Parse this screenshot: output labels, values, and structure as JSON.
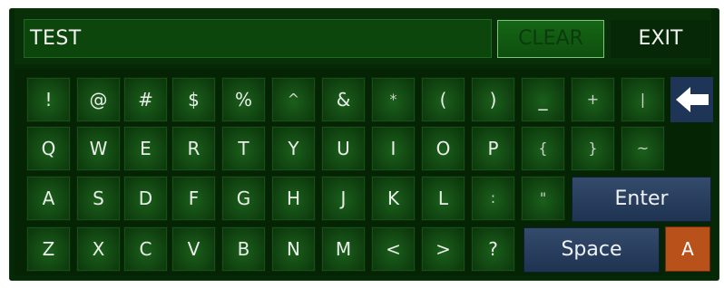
{
  "input": {
    "value": "TEST"
  },
  "buttons": {
    "clear": "CLEAR",
    "exit": "EXIT",
    "enter": "Enter",
    "space": "Space",
    "mode": "A"
  },
  "rows": [
    [
      "!",
      "@",
      "#",
      "$",
      "%",
      "^",
      "&",
      "*",
      "(",
      ")",
      "_",
      "+",
      "|"
    ],
    [
      "Q",
      "W",
      "E",
      "R",
      "T",
      "Y",
      "U",
      "I",
      "O",
      "P",
      "{",
      "}",
      "~"
    ],
    [
      "A",
      "S",
      "D",
      "F",
      "G",
      "H",
      "J",
      "K",
      "L",
      ":",
      "\""
    ],
    [
      "Z",
      "X",
      "C",
      "V",
      "B",
      "N",
      "M",
      "<",
      ">",
      "?"
    ]
  ],
  "icons": {
    "backspace": "backspace-arrow-icon"
  },
  "colors": {
    "key": "#145214",
    "accent_blue": "#2a4263",
    "mode": "#b8521a",
    "clear_border": "#7cc37c"
  }
}
